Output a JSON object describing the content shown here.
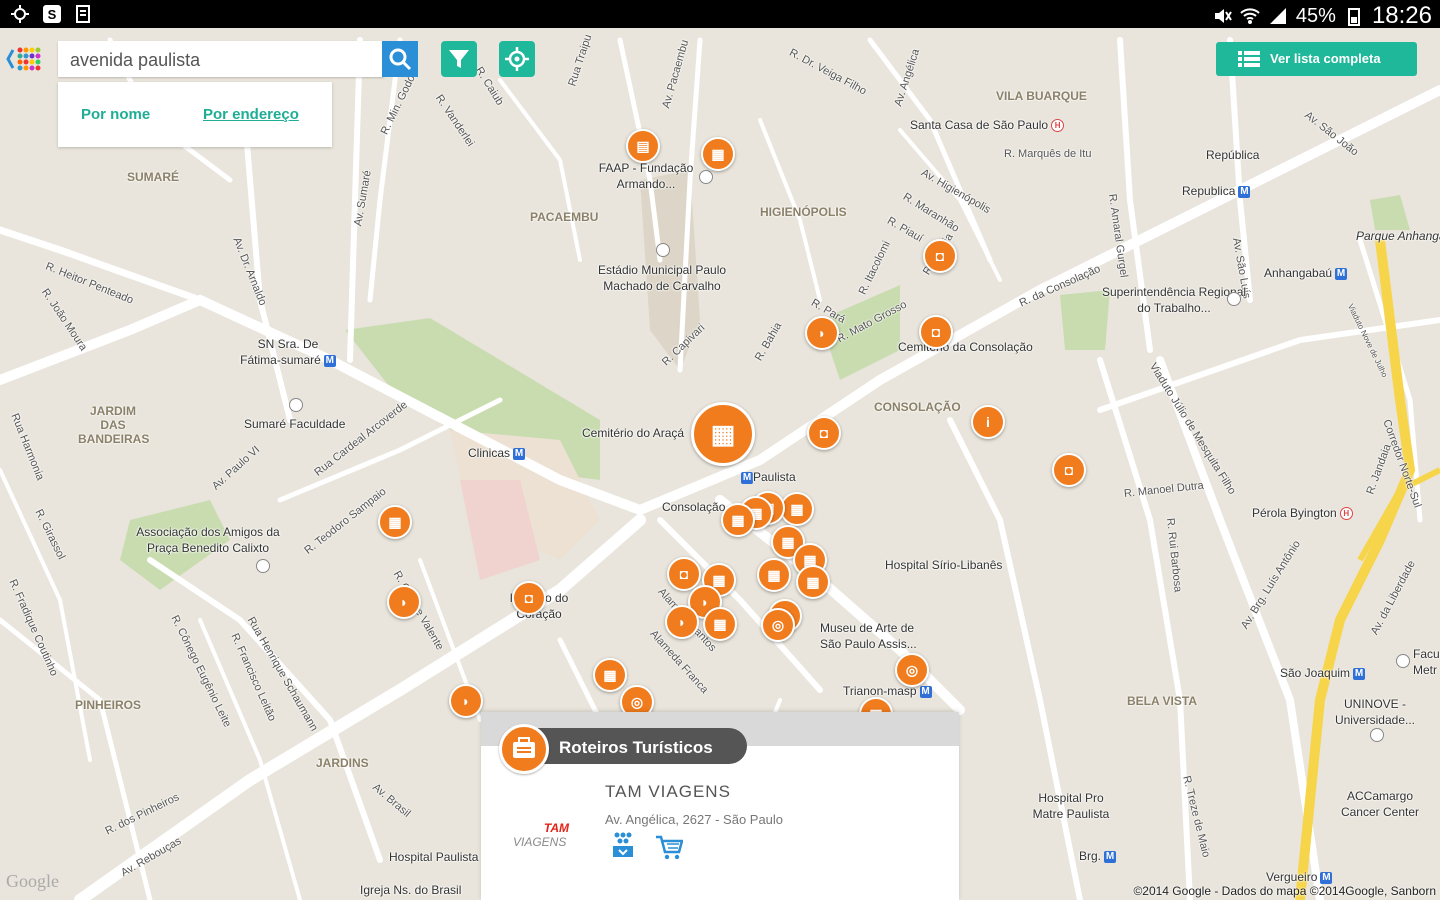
{
  "status_bar": {
    "battery": "45%",
    "time": "18:26",
    "icons": [
      "brightness-icon",
      "skype-icon",
      "document-icon",
      "mute-icon",
      "wifi-icon",
      "signal-icon",
      "battery-icon"
    ]
  },
  "search": {
    "value": "avenida paulista",
    "placeholder": "",
    "options": {
      "by_name": "Por nome",
      "by_address": "Por endereço"
    }
  },
  "toolbar": {
    "full_list": "Ver lista completa",
    "icons": [
      "search-icon",
      "filter-icon",
      "locate-icon",
      "list-icon"
    ]
  },
  "map": {
    "districts": [
      "SUMARÉ",
      "PACAEMBU",
      "HIGIENÓPOLIS",
      "VILA BUARQUE",
      "CONSOLAÇÃO",
      "JARDIM DAS BANDEIRAS",
      "PINHEIROS",
      "JARDINS",
      "BELA VISTA"
    ],
    "places": {
      "faap": "FAAP - Fundação Armando...",
      "estadio": "Estádio Municipal Paulo Machado de Carvalho",
      "santa_casa": "Santa Casa de São Paulo",
      "republica1": "República",
      "republica2": "Republica",
      "parque": "Parque Anhanga",
      "anhangabau": "Anhangabaú",
      "superintendencia": "Superintendência Regional do Trabalho...",
      "cemiterio_consolacao": "Cemitério da Consolação",
      "sn_sra": "SN Sra. De Fátima-sumaré",
      "sumare_faculdade": "Sumaré Faculdade",
      "cemiterio_araca": "Cemitério do Araçá",
      "clinicas": "Clinicas",
      "paulista": "Paulista",
      "consolacao_station": "Consolação",
      "associacao": "Associação dos Amigos da Praça Benedito Calixto",
      "instituto": "Instituto do Coração",
      "hospital_sirio": "Hospital Sírio-Libanês",
      "perola": "Pérola Byington",
      "masp": "Museu de Arte de São Paulo Assis...",
      "trianon": "Trianon-masp",
      "sao_joaquim": "São Joaquim",
      "uninove": "UNINOVE - Universidade...",
      "facu": "Facu Metr",
      "hospital_pro_matre": "Hospital Pro Matre Paulista",
      "accamargo": "ACCamargo Cancer Center",
      "brg": "Brg.",
      "vergueiro": "Vergueiro",
      "hospital_paulista": "Hospital Paulista",
      "igreja": "Igreja Ns. do Brasil"
    },
    "streets": [
      "R. Dr. Veiga Filho",
      "Av. Angélica",
      "Av. Higienópolis",
      "R. Maranhão",
      "R. Piauí",
      "R. Marquês de Itu",
      "R. Amaral Gurgel",
      "Av. São Luís",
      "Av. São João",
      "R. da Consolação",
      "Av. Pacaembu",
      "Rua Traipu",
      "R. Caiub",
      "R. Min. Godói",
      "R. Vanderlei",
      "R. Heitor Penteado",
      "R. João Moura",
      "Av. Dr. Arnaldo",
      "Av. Sumaré",
      "R. Pará",
      "R. Itacolomi",
      "R. Mato Grosso",
      "R. Itatiaia",
      "R. Capivari",
      "R. Bahia",
      "Rua Harmonia",
      "R. Girassol",
      "R. Fradique Coutinho",
      "Av. Paulo VI",
      "Rua Cardeal Arcoverde",
      "R. Teodoro Sampaio",
      "R. Capote Valente",
      "R. Cônego Eugênio Leite",
      "R. Francisco Leitão",
      "Rua Henrique Schaumann",
      "Alameda Franca",
      "Alameda Santos",
      "Viaduto Júlio de Mesquita Filho",
      "R. Manoel Dutra",
      "R. Rui Barbosa",
      "Av. Brg. Luís Antônio",
      "Av. da Liberdade",
      "R. Treze de Maio",
      "Av. Brasil",
      "R. dos Pinheiros",
      "Av. Rebouças",
      "Corredor Norte-Sul",
      "R. Jandaia",
      "Viaduto Nove de Julho"
    ],
    "attribution": "©2014 Google - Dados do mapa ©2014Google, Sanborn",
    "google": "Google"
  },
  "card": {
    "category": "Roteiros Turísticos",
    "company": "TAM VIAGENS",
    "address": "Av. Angélica, 2627 - São Paulo",
    "logo_text_1": "TAM",
    "logo_text_2": "VIAGENS",
    "colors": {
      "accent": "#f07c1e",
      "teal": "#20b89a",
      "blue": "#2a8fd6"
    }
  }
}
